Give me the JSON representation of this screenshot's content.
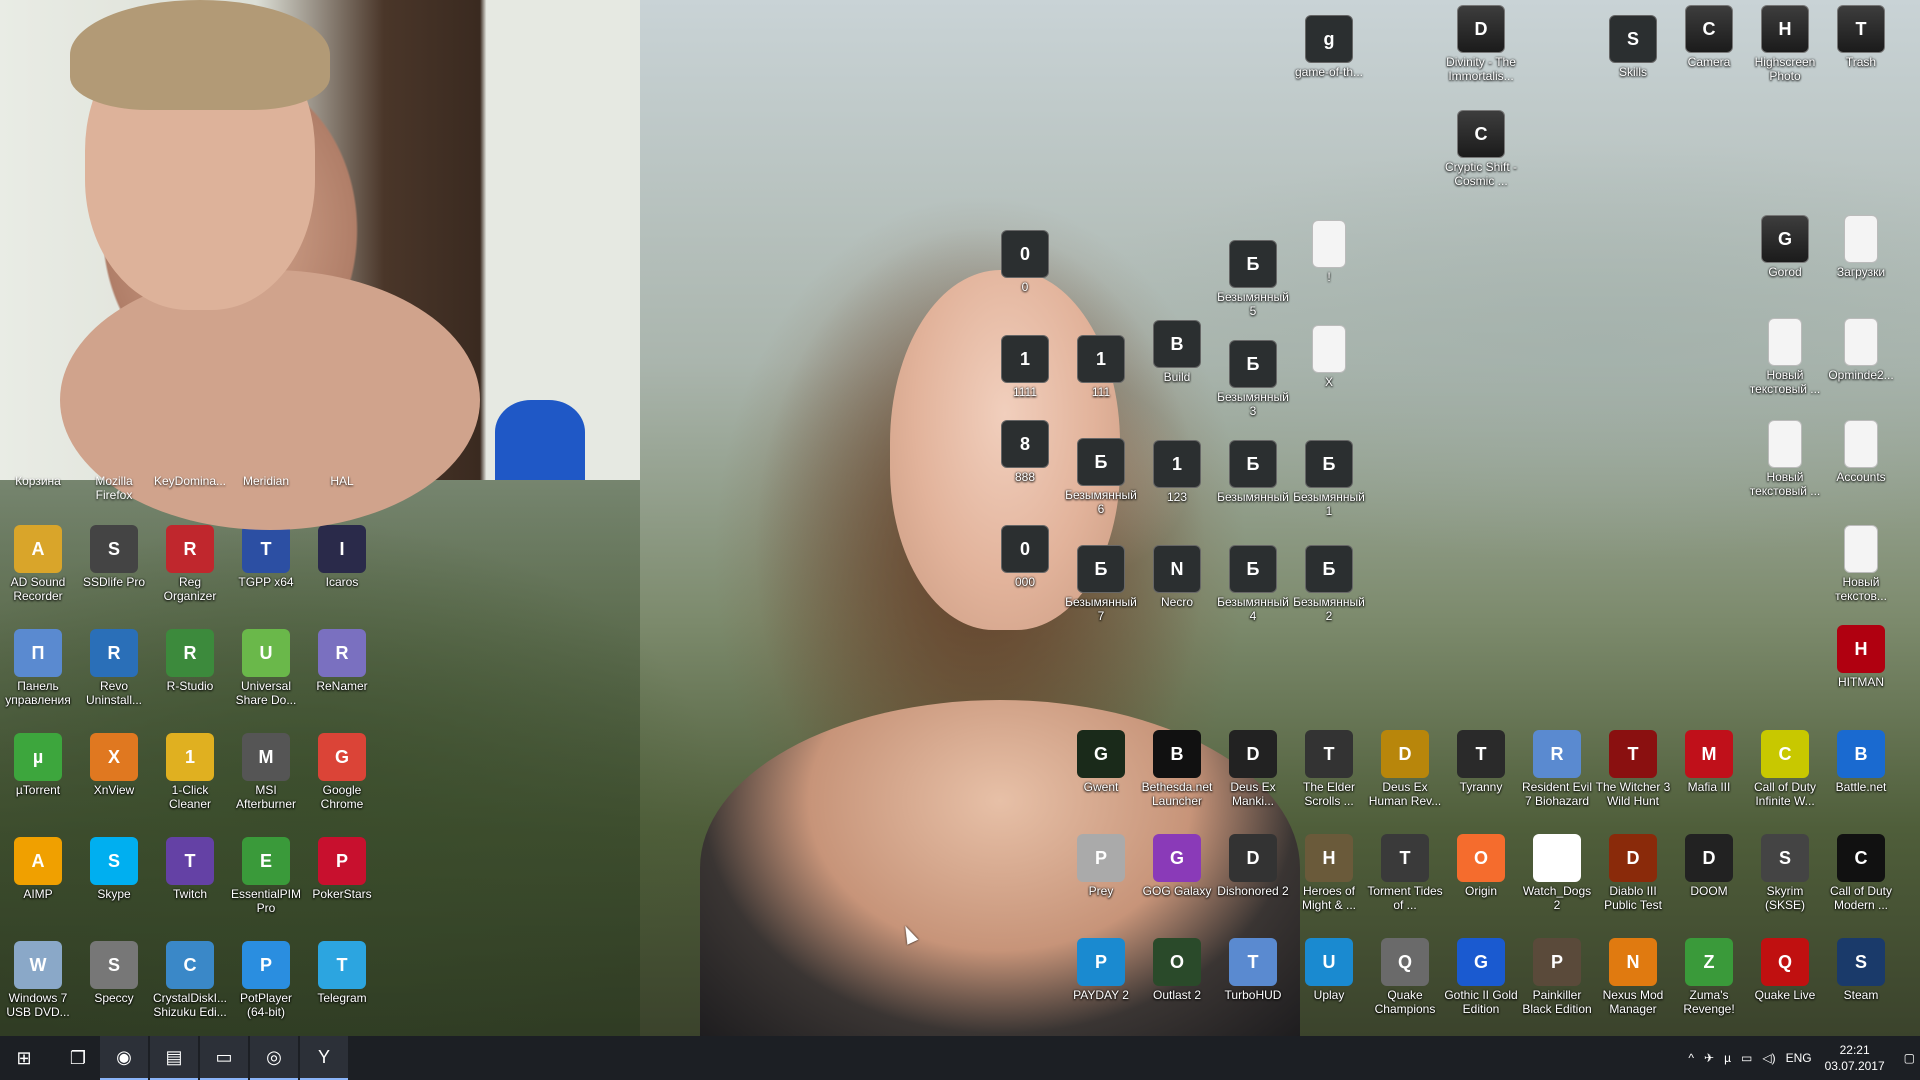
{
  "desktop": {
    "left_partial_labels": [
      "Корзина",
      "Mozilla Firefox",
      "KeyDomina...",
      "Meridian",
      "HAL"
    ],
    "icons_left": [
      {
        "label": "AD Sound Recorder",
        "icon": "speaker-icon",
        "color": "#d9a52a"
      },
      {
        "label": "SSDlife Pro",
        "icon": "ssd-chip-icon",
        "color": "#444444"
      },
      {
        "label": "Reg Organizer",
        "icon": "reg-organizer-icon",
        "color": "#c0272d"
      },
      {
        "label": "TGPP x64",
        "icon": "floppy-icon",
        "color": "#2c4fa3"
      },
      {
        "label": "Icaros",
        "icon": "icaros-icon",
        "color": "#2a2a4a"
      },
      {
        "label": "Панель управления",
        "icon": "control-panel-icon",
        "color": "#5a8ad0"
      },
      {
        "label": "Revo Uninstall...",
        "icon": "revo-icon",
        "color": "#2a6fb8"
      },
      {
        "label": "R-Studio",
        "icon": "r-studio-icon",
        "color": "#3c8a3c"
      },
      {
        "label": "Universal Share Do...",
        "icon": "universal-share-icon",
        "color": "#6ab84a"
      },
      {
        "label": "ReNamer",
        "icon": "renamer-icon",
        "color": "#7a70c0"
      },
      {
        "label": "µTorrent",
        "icon": "utorrent-icon",
        "color": "#3da63d"
      },
      {
        "label": "XnView",
        "icon": "xnview-icon",
        "color": "#e07820"
      },
      {
        "label": "1-Click Cleaner",
        "icon": "broom-icon",
        "color": "#e0b020"
      },
      {
        "label": "MSI Afterburner",
        "icon": "afterburner-icon",
        "color": "#555555"
      },
      {
        "label": "Google Chrome",
        "icon": "chrome-icon",
        "color": "#db4437"
      },
      {
        "label": "AIMP",
        "icon": "aimp-icon",
        "color": "#f0a000"
      },
      {
        "label": "Skype",
        "icon": "skype-icon",
        "color": "#00aff0"
      },
      {
        "label": "Twitch",
        "icon": "twitch-icon",
        "color": "#6441a5"
      },
      {
        "label": "EssentialPIM Pro",
        "icon": "essentialpim-icon",
        "color": "#3a9a3a"
      },
      {
        "label": "PokerStars",
        "icon": "pokerstars-icon",
        "color": "#c8102e"
      },
      {
        "label": "Windows 7 USB DVD...",
        "icon": "usb-dvd-icon",
        "color": "#8aa8c8"
      },
      {
        "label": "Speccy",
        "icon": "speccy-icon",
        "color": "#777777"
      },
      {
        "label": "CrystalDiskI... Shizuku Edi...",
        "icon": "crystaldisk-icon",
        "color": "#3a88c8"
      },
      {
        "label": "PotPlayer (64-bit)",
        "icon": "potplayer-icon",
        "color": "#2a8ee0"
      },
      {
        "label": "Telegram",
        "icon": "telegram-icon",
        "color": "#2ca5e0"
      }
    ],
    "icons_center": [
      {
        "label": "0",
        "icon": "screenshot-thumb-icon"
      },
      {
        "label": "1111",
        "icon": "screenshot-thumb-icon"
      },
      {
        "label": "111",
        "icon": "screenshot-thumb-icon"
      },
      {
        "label": "Build",
        "icon": "build-thumb-icon"
      },
      {
        "label": "Безымянный 5",
        "icon": "image-thumb-icon"
      },
      {
        "label": "!",
        "icon": "text-file-icon"
      },
      {
        "label": "Безымянный 3",
        "icon": "image-thumb-icon"
      },
      {
        "label": "X",
        "icon": "text-file-icon"
      },
      {
        "label": "888",
        "icon": "image-thumb-icon"
      },
      {
        "label": "Безымянный 6",
        "icon": "image-thumb-icon"
      },
      {
        "label": "123",
        "icon": "image-thumb-icon"
      },
      {
        "label": "Безымянный",
        "icon": "image-thumb-icon"
      },
      {
        "label": "Безымянный 1",
        "icon": "image-thumb-icon"
      },
      {
        "label": "000",
        "icon": "image-thumb-icon"
      },
      {
        "label": "Безымянный 7",
        "icon": "image-thumb-icon"
      },
      {
        "label": "Necro",
        "icon": "image-thumb-icon"
      },
      {
        "label": "Безымянный 4",
        "icon": "image-thumb-icon"
      },
      {
        "label": "Безымянный 2",
        "icon": "image-thumb-icon"
      }
    ],
    "icons_top_right": [
      {
        "label": "game-of-th...",
        "icon": "image-thumb-icon"
      },
      {
        "label": "Divinity - The Immortalis...",
        "icon": "folder-icon"
      },
      {
        "label": "Skills",
        "icon": "image-thumb-icon"
      },
      {
        "label": "Camera",
        "icon": "folder-icon"
      },
      {
        "label": "Highscreen Photo",
        "icon": "folder-icon"
      },
      {
        "label": "Trash",
        "icon": "folder-icon"
      },
      {
        "label": "Cryptic Shift - Cosmic ...",
        "icon": "folder-icon"
      },
      {
        "label": "Gorod",
        "icon": "folder-icon"
      },
      {
        "label": "Загрузки",
        "icon": "downloads-icon"
      },
      {
        "label": "Новый текстовый ...",
        "icon": "text-file-icon"
      },
      {
        "label": "Opminde2...",
        "icon": "document-icon"
      },
      {
        "label": "Новый текстовый ...",
        "icon": "text-file-icon"
      },
      {
        "label": "Accounts",
        "icon": "text-file-icon"
      },
      {
        "label": "Новый текстов...",
        "icon": "text-file-icon"
      },
      {
        "label": "HITMAN",
        "icon": "hitman-icon"
      }
    ],
    "icons_games": [
      {
        "label": "Gwent",
        "icon": "gwent-icon",
        "color": "#1a2a1a"
      },
      {
        "label": "Bethesda.net Launcher",
        "icon": "bethesda-icon",
        "color": "#111111"
      },
      {
        "label": "Deus Ex Manki...",
        "icon": "deus-ex-md-icon",
        "color": "#222222"
      },
      {
        "label": "The Elder Scrolls ...",
        "icon": "elder-scrolls-icon",
        "color": "#333333"
      },
      {
        "label": "Deus Ex Human Rev...",
        "icon": "deus-ex-hr-icon",
        "color": "#b8860b"
      },
      {
        "label": "Tyranny",
        "icon": "tyranny-icon",
        "color": "#2a2a2a"
      },
      {
        "label": "Resident Evil 7 Biohazard",
        "icon": "control-panel-icon",
        "color": "#5a8ad0"
      },
      {
        "label": "The Witcher 3 Wild Hunt",
        "icon": "witcher-icon",
        "color": "#8a1010"
      },
      {
        "label": "Mafia III",
        "icon": "mafia-icon",
        "color": "#c0101a"
      },
      {
        "label": "Call of Duty Infinite W...",
        "icon": "cod-iw-icon",
        "color": "#c8c800"
      },
      {
        "label": "Battle.net",
        "icon": "battlenet-icon",
        "color": "#1a6ad0"
      },
      {
        "label": "Prey",
        "icon": "prey-icon",
        "color": "#aaaaaa"
      },
      {
        "label": "GOG Galaxy",
        "icon": "gog-icon",
        "color": "#8a3ab8"
      },
      {
        "label": "Dishonored 2",
        "icon": "dishonored-icon",
        "color": "#333333"
      },
      {
        "label": "Heroes of Might & ...",
        "icon": "heroes-icon",
        "color": "#6a5a3a"
      },
      {
        "label": "Torment Tides of ...",
        "icon": "torment-icon",
        "color": "#3a3a3a"
      },
      {
        "label": "Origin",
        "icon": "origin-icon",
        "color": "#f56c2d"
      },
      {
        "label": "Watch_Dogs 2",
        "icon": "watchdogs-icon",
        "color": "#ffffff"
      },
      {
        "label": "Diablo III Public Test",
        "icon": "diablo-icon",
        "color": "#8a2a0a"
      },
      {
        "label": "DOOM",
        "icon": "doom-icon",
        "color": "#222222"
      },
      {
        "label": "Skyrim (SKSE)",
        "icon": "skyrim-icon",
        "color": "#444444"
      },
      {
        "label": "Call of Duty Modern ...",
        "icon": "cod-mw-icon",
        "color": "#111111"
      },
      {
        "label": "PAYDAY 2",
        "icon": "payday-icon",
        "color": "#1a8ad0"
      },
      {
        "label": "Outlast 2",
        "icon": "outlast-icon",
        "color": "#2a4a2a"
      },
      {
        "label": "TurboHUD",
        "icon": "control-panel-icon",
        "color": "#5a8ad0"
      },
      {
        "label": "Uplay",
        "icon": "uplay-icon",
        "color": "#1a8ad0"
      },
      {
        "label": "Quake Champions",
        "icon": "quake-icon",
        "color": "#6a6a6a"
      },
      {
        "label": "Gothic II Gold Edition",
        "icon": "gothic-icon",
        "color": "#1a5ad0"
      },
      {
        "label": "Painkiller Black Edition",
        "icon": "painkiller-icon",
        "color": "#5a4a3a"
      },
      {
        "label": "Nexus Mod Manager",
        "icon": "nexus-icon",
        "color": "#e07a10"
      },
      {
        "label": "Zuma's Revenge!",
        "icon": "zuma-icon",
        "color": "#3a9a3a"
      },
      {
        "label": "Quake Live",
        "icon": "quake-live-icon",
        "color": "#c01010"
      },
      {
        "label": "Steam",
        "icon": "steam-icon",
        "color": "#1a3a6a"
      }
    ]
  },
  "taskbar": {
    "items": [
      {
        "icon": "windows-start-icon",
        "glyph": "⊞"
      },
      {
        "icon": "task-view-icon",
        "glyph": "❐"
      },
      {
        "icon": "firefox-icon",
        "glyph": "◉"
      },
      {
        "icon": "terminal-icon",
        "glyph": "▤"
      },
      {
        "icon": "file-explorer-icon",
        "glyph": "▭"
      },
      {
        "icon": "obs-icon",
        "glyph": "◎"
      },
      {
        "icon": "yandex-icon",
        "glyph": "Y"
      }
    ],
    "tray": {
      "chevron": "^",
      "lang": "ENG",
      "time": "22:21",
      "date": "03.07.2017"
    }
  }
}
